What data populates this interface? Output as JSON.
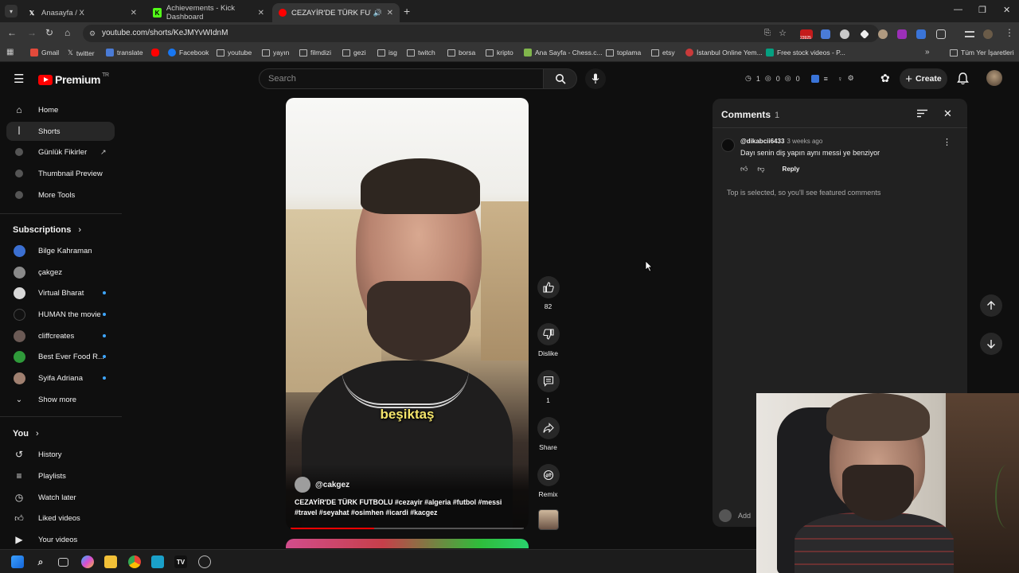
{
  "browser": {
    "tabs": [
      {
        "title": "Anasayfa / X",
        "icon": "x-icon",
        "active": false
      },
      {
        "title": "Achievements - Kick Dashboard",
        "icon": "kick-icon",
        "active": false
      },
      {
        "title": "CEZAYİR'DE TÜRK FUTBOLU",
        "icon": "youtube-icon",
        "active": true
      }
    ],
    "url": "youtube.com/shorts/KeJMYvWIdnM",
    "ext_badge": "23925",
    "bookmarks": [
      "Gmail",
      "twitter",
      "translate",
      "",
      "Facebook",
      "youtube",
      "yayın",
      "filmdizi",
      "gezi",
      "isg",
      "twitch",
      "borsa",
      "kripto",
      "Ana Sayfa - Chess.c...",
      "toplama",
      "etsy",
      "İstanbul Online Yem...",
      "Free stock videos - P..."
    ],
    "bookmarks_right": "Tüm Yer İşaretleri"
  },
  "header": {
    "logo_text": "Premium",
    "logo_region": "TR",
    "search_placeholder": "Search",
    "stats": [
      "1",
      "0",
      "0"
    ],
    "create_label": "Create"
  },
  "sidebar": {
    "main": [
      {
        "label": "Home",
        "icon": "home-icon"
      },
      {
        "label": "Shorts",
        "icon": "shorts-icon",
        "active": true
      },
      {
        "label": "Günlük Fikirler",
        "icon": "extension-icon",
        "external": true
      },
      {
        "label": "Thumbnail Preview",
        "icon": "extension-icon"
      },
      {
        "label": "More Tools",
        "icon": "extension-icon"
      }
    ],
    "subscriptions_heading": "Subscriptions",
    "subscriptions": [
      {
        "label": "Bilge Kahraman",
        "color": "#3b6fd1",
        "new": false
      },
      {
        "label": "çakgez",
        "color": "#8a8a8a",
        "new": false
      },
      {
        "label": "Virtual Bharat",
        "color": "#d8d8d8",
        "new": true
      },
      {
        "label": "HUMAN the movie",
        "color": "#111111",
        "new": true
      },
      {
        "label": "cliffcreates",
        "color": "#6b5a55",
        "new": true
      },
      {
        "label": "Best Ever Food R...",
        "color": "#2f9a3a",
        "new": true
      },
      {
        "label": "Syifa Adriana",
        "color": "#a08070",
        "new": true
      }
    ],
    "show_more": "Show more",
    "you_heading": "You",
    "you_items": [
      {
        "label": "History",
        "icon": "history-icon"
      },
      {
        "label": "Playlists",
        "icon": "playlists-icon"
      },
      {
        "label": "Watch later",
        "icon": "clock-icon"
      },
      {
        "label": "Liked videos",
        "icon": "thumbs-up-icon"
      },
      {
        "label": "Your videos",
        "icon": "video-icon"
      }
    ]
  },
  "short": {
    "caption": "beşiktaş",
    "channel": "@cakgez",
    "title": "CEZAYİR'DE TÜRK FUTBOLU #cezayir #algeria #futbol #messi #travel #seyahat #osimhen #icardi #kacgez",
    "progress": 0.36
  },
  "actions": {
    "likes": "82",
    "dislike": "Dislike",
    "comments": "1",
    "share": "Share",
    "remix": "Remix"
  },
  "comments_panel": {
    "title": "Comments",
    "count": "1",
    "comment": {
      "user": "@dikabcii6433",
      "time": "3 weeks ago",
      "text": "Dayı senin diş yapın aynı messi ye benziyor",
      "reply": "Reply"
    },
    "note": "Top is selected, so you'll see featured comments",
    "add_placeholder": "Add"
  }
}
